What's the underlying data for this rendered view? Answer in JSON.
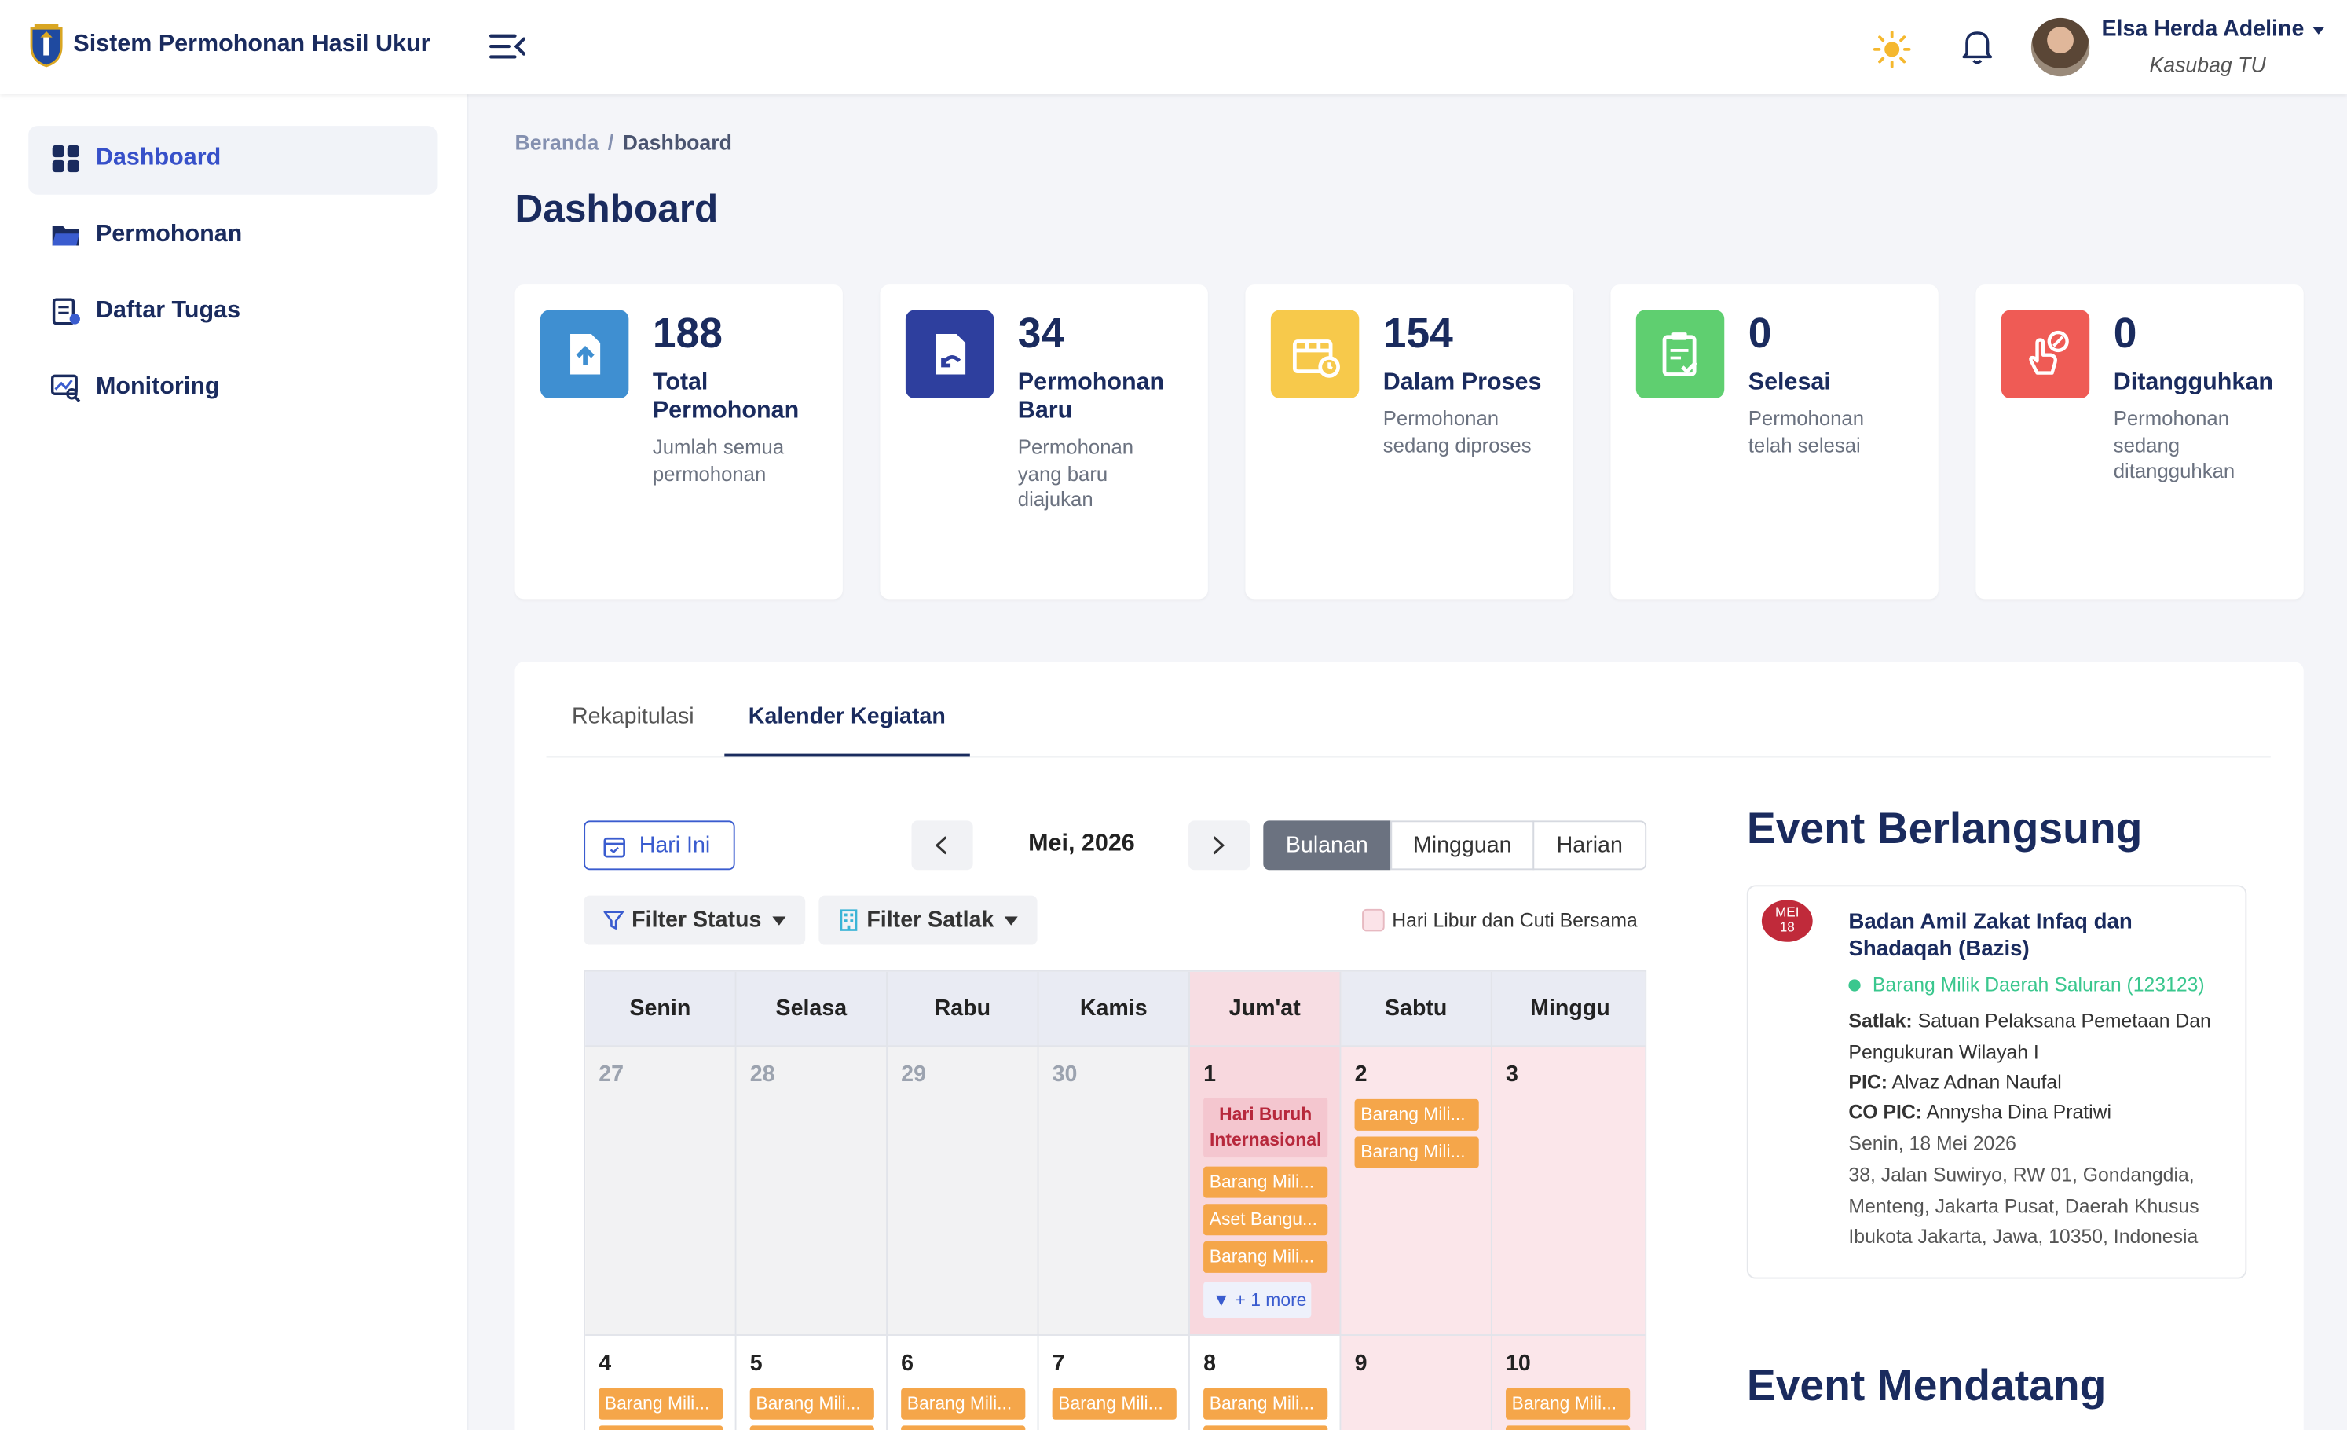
{
  "app": {
    "title": "Sistem Permohonan Hasil Ukur"
  },
  "user": {
    "name": "Elsa Herda Adeline",
    "role": "Kasubag TU"
  },
  "sidebar": {
    "items": [
      {
        "label": "Dashboard",
        "icon": "dashboard-icon",
        "active": true
      },
      {
        "label": "Permohonan",
        "icon": "folder-icon"
      },
      {
        "label": "Daftar Tugas",
        "icon": "task-list-icon"
      },
      {
        "label": "Monitoring",
        "icon": "monitoring-icon"
      }
    ]
  },
  "breadcrumb": {
    "home": "Beranda",
    "separator": "/",
    "current": "Dashboard"
  },
  "page": {
    "title": "Dashboard"
  },
  "stats": [
    {
      "value": "188",
      "title": "Total Permohonan",
      "desc": "Jumlah semua permohonan",
      "color": "#3f8fd1"
    },
    {
      "value": "34",
      "title": "Permohonan Baru",
      "desc": "Permohonan yang baru diajukan",
      "color": "#2e3f9e"
    },
    {
      "value": "154",
      "title": "Dalam Proses",
      "desc": "Permohonan sedang diproses",
      "color": "#f7c94b"
    },
    {
      "value": "0",
      "title": "Selesai",
      "desc": "Permohonan telah selesai",
      "color": "#5fcf70"
    },
    {
      "value": "0",
      "title": "Ditangguhkan",
      "desc": "Permohonan sedang ditangguhkan",
      "color": "#ef5b55"
    }
  ],
  "tabs": [
    {
      "label": "Rekapitulasi",
      "active": false
    },
    {
      "label": "Kalender Kegiatan",
      "active": true
    }
  ],
  "calendar": {
    "today_label": "Hari Ini",
    "title": "Mei, 2026",
    "views": [
      "Bulanan",
      "Mingguan",
      "Harian"
    ],
    "active_view": "Bulanan",
    "filter_status": "Filter Status",
    "filter_satlak": "Filter Satlak",
    "legend": "Hari Libur dan Cuti Bersama",
    "weekdays": [
      "Senin",
      "Selasa",
      "Rabu",
      "Kamis",
      "Jum'at",
      "Sabtu",
      "Minggu"
    ],
    "week1": {
      "days": [
        "27",
        "28",
        "29",
        "30",
        "1",
        "2",
        "3"
      ],
      "holiday": "Hari Buruh Internasional",
      "fri_events": [
        "Barang Mili...",
        "Aset Bangu...",
        "Barang Mili..."
      ],
      "more": "▼ + 1 more",
      "sat_events": [
        "Barang Mili...",
        "Barang Mili..."
      ]
    },
    "week2": {
      "days": [
        "4",
        "5",
        "6",
        "7",
        "8",
        "9",
        "10"
      ],
      "event": "Barang Mili..."
    }
  },
  "events": {
    "current_heading": "Event Berlangsung",
    "upcoming_heading": "Event Mendatang",
    "current": {
      "badge_month": "MEI",
      "badge_day": "18",
      "title": "Badan Amil Zakat Infaq dan Shadaqah (Bazis)",
      "status": "Barang Milik Daerah Saluran (123123)",
      "satlak_label": "Satlak:",
      "satlak": "Satuan Pelaksana Pemetaan Dan Pengukuran Wilayah I",
      "pic_label": "PIC:",
      "pic": "Alvaz Adnan Naufal",
      "copic_label": "CO PIC:",
      "copic": "Annysha Dina Pratiwi",
      "date": "Senin, 18 Mei 2026",
      "address": "38, Jalan Suwiryo, RW 01, Gondangdia, Menteng, Jakarta Pusat, Daerah Khusus Ibukota Jakarta, Jawa, 10350, Indonesia"
    }
  }
}
